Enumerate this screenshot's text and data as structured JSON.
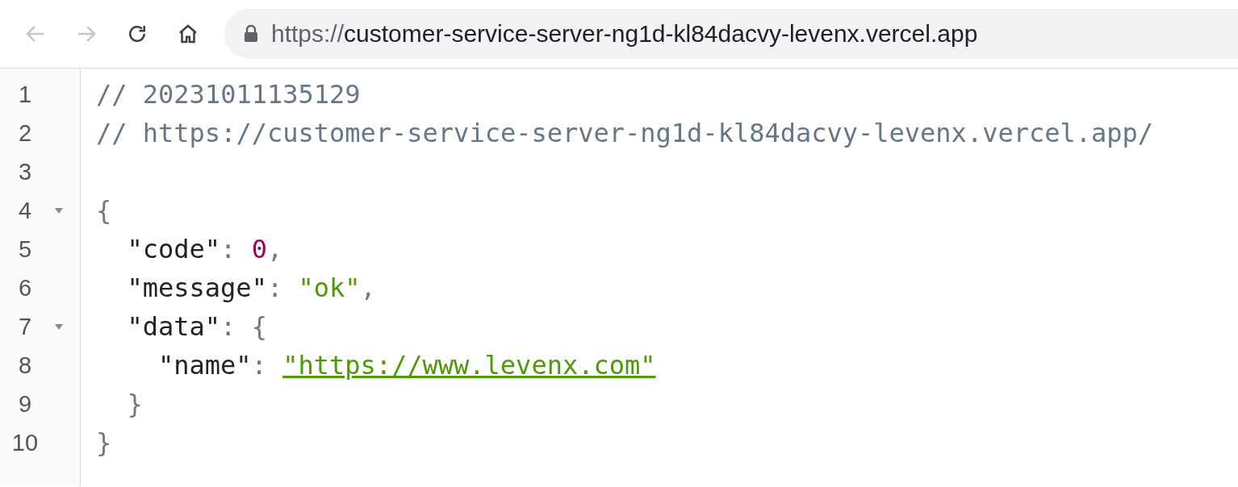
{
  "toolbar": {
    "back": {
      "disabled": true
    },
    "forward": {
      "disabled": true
    },
    "reload": {
      "disabled": false
    },
    "home": {
      "disabled": false
    }
  },
  "address_bar": {
    "secure": true,
    "scheme": "https://",
    "host": "customer-service-server-ng1d-kl84dacvy-levenx.vercel.app"
  },
  "code_lines": [
    {
      "number": "1",
      "tokens": [
        {
          "kind": "comment",
          "text": "// 20231011135129"
        }
      ]
    },
    {
      "number": "2",
      "tokens": [
        {
          "kind": "comment",
          "text": "// https://customer-service-server-ng1d-kl84dacvy-levenx.vercel.app/"
        }
      ]
    },
    {
      "number": "3"
    },
    {
      "number": "4",
      "expanded": true,
      "tokens": [
        {
          "kind": "punct",
          "text": "{"
        }
      ],
      "children": [
        {
          "number": "5",
          "tokens": [
            {
              "kind": "key",
              "text": "\"code\""
            },
            {
              "kind": "punct",
              "text": ": "
            },
            {
              "kind": "number",
              "text": "0"
            },
            {
              "kind": "punct",
              "text": ","
            }
          ]
        },
        {
          "number": "6",
          "tokens": [
            {
              "kind": "key",
              "text": "\"message\""
            },
            {
              "kind": "punct",
              "text": ": "
            },
            {
              "kind": "string",
              "text": "\"ok\""
            },
            {
              "kind": "punct",
              "text": ","
            }
          ]
        },
        {
          "number": "7",
          "expanded": true,
          "tokens": [
            {
              "kind": "key",
              "text": "\"data\""
            },
            {
              "kind": "punct",
              "text": ": "
            },
            {
              "kind": "punct",
              "text": "{"
            }
          ],
          "children": [
            {
              "number": "8",
              "tokens": [
                {
                  "kind": "key",
                  "text": "\"name\""
                },
                {
                  "kind": "punct",
                  "text": ": "
                },
                {
                  "kind": "link",
                  "text": "\"https://www.levenx.com\""
                }
              ]
            }
          ]
        },
        {
          "number": "9",
          "tokens": [
            {
              "kind": "punct",
              "text": "}"
            }
          ]
        }
      ]
    },
    {
      "number": "10",
      "tokens": [
        {
          "kind": "punct",
          "text": "}"
        }
      ]
    }
  ]
}
